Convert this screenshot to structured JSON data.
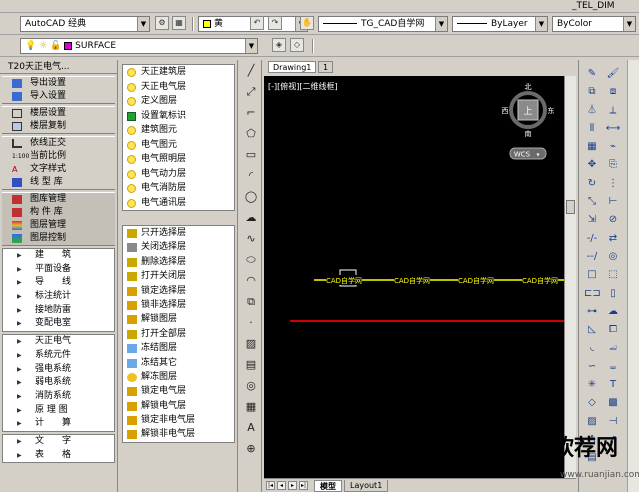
{
  "topbar": {
    "right_label": "_TEL_DIM"
  },
  "toolbar2": {
    "workspace": "AutoCAD 经典",
    "layer_color_name": "黄",
    "layer_color": "#ffff00",
    "linetype": "TG_CAD自学网",
    "lineweight": "ByLayer",
    "plotstyle": "ByColor"
  },
  "toolbar3": {
    "layer_name": "SURFACE",
    "layer_swatch": "#d900d9"
  },
  "left_panel": {
    "title": "T20天正电气...",
    "group1": [
      "导出设置",
      "导入设置"
    ],
    "group2": [
      "楼层设置",
      "楼层复制"
    ],
    "group3": [
      "依线正交",
      "当前比例",
      "文字样式",
      "线 型 库"
    ],
    "group4": [
      "图库管理",
      "构 件 库",
      "图层管理",
      "图层控制"
    ],
    "menu1": [
      "建　　筑",
      "平面设备",
      "导　　线",
      "标注统计",
      "接地防雷",
      "变配电室"
    ],
    "menu2": [
      "天正电气",
      "系统元件",
      "强电系统",
      "弱电系统",
      "消防系统",
      "原 理 图",
      "计　　算"
    ],
    "menu3": [
      "文　　字",
      "表　　格"
    ]
  },
  "layer_panel": {
    "group1": [
      "天正建筑层",
      "天正电气层",
      "定义图层",
      "设置氧标识",
      "建筑图元",
      "电气图元",
      "电气照明层",
      "电气动力层",
      "电气消防层",
      "电气通讯层"
    ],
    "group2": [
      "只开选择层",
      "关闭选择层",
      "删除选择层",
      "打开关闭层",
      "锁定选择层",
      "锁非选择层",
      "解锁图层",
      "打开全部层",
      "冻结图层",
      "冻结其它",
      "解冻图层",
      "锁定电气层",
      "解锁电气层",
      "锁定非电气层",
      "解锁非电气层"
    ]
  },
  "drawing": {
    "tab_name": "Drawing1",
    "tab_extra": "1",
    "viewport_label": "[-][俯视][二维线框]",
    "compass": {
      "north": "北",
      "south": "南",
      "east": "东",
      "west": "西",
      "center": "上"
    },
    "wcs_label": "WCS",
    "wire_label": "CAD自学网",
    "wire_color": "#ffff00",
    "red_line_color": "#cc0000",
    "bottom_tabs": [
      "模型",
      "Layout1"
    ]
  },
  "watermark": {
    "text": "软荐网",
    "url": "www.ruanjian.com"
  }
}
